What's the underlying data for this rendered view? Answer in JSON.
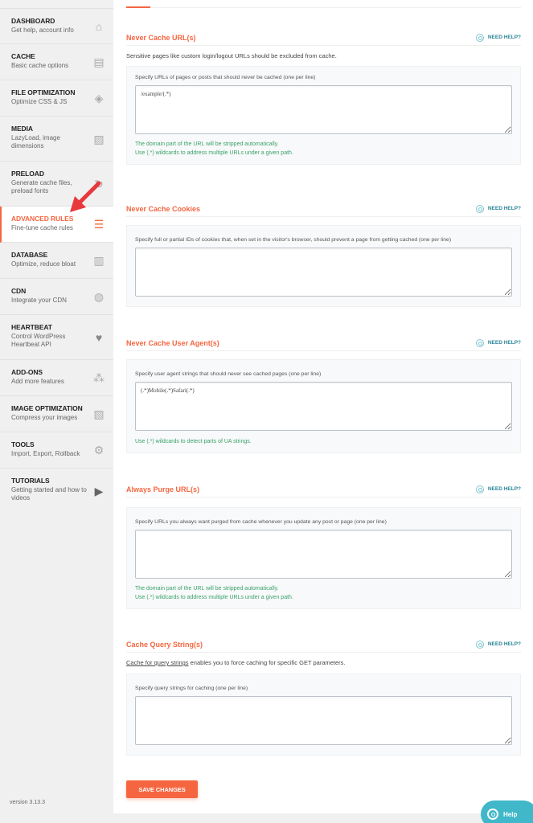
{
  "sidebar": {
    "items": [
      {
        "title": "DASHBOARD",
        "subtitle": "Get help, account info",
        "icon": "home-icon",
        "glyph": "⌂"
      },
      {
        "title": "CACHE",
        "subtitle": "Basic cache options",
        "icon": "document-icon",
        "glyph": "▤"
      },
      {
        "title": "FILE OPTIMIZATION",
        "subtitle": "Optimize CSS & JS",
        "icon": "layers-icon",
        "glyph": "◈"
      },
      {
        "title": "MEDIA",
        "subtitle": "LazyLoad, image dimensions",
        "icon": "images-icon",
        "glyph": "▨"
      },
      {
        "title": "PRELOAD",
        "subtitle": "Generate cache files, preload fonts",
        "icon": "refresh-icon",
        "glyph": "↻"
      },
      {
        "title": "ADVANCED RULES",
        "subtitle": "Fine-tune cache rules",
        "icon": "list-icon",
        "glyph": "☰",
        "active": true
      },
      {
        "title": "DATABASE",
        "subtitle": "Optimize, reduce bloat",
        "icon": "database-icon",
        "glyph": "▥"
      },
      {
        "title": "CDN",
        "subtitle": "Integrate your CDN",
        "icon": "globe-hand-icon",
        "glyph": "◍"
      },
      {
        "title": "HEARTBEAT",
        "subtitle": "Control WordPress Heartbeat API",
        "icon": "heartbeat-icon",
        "glyph": "♥"
      },
      {
        "title": "ADD-ONS",
        "subtitle": "Add more features",
        "icon": "cubes-icon",
        "glyph": "⁂"
      },
      {
        "title": "IMAGE OPTIMIZATION",
        "subtitle": "Compress your images",
        "icon": "image-compress-icon",
        "glyph": "▧"
      },
      {
        "title": "TOOLS",
        "subtitle": "Import, Export, Rollback",
        "icon": "file-gear-icon",
        "glyph": "⚙"
      },
      {
        "title": "TUTORIALS",
        "subtitle": "Getting started and how to videos",
        "icon": "play-icon",
        "glyph": "▶"
      }
    ],
    "version": "version 3.13.3"
  },
  "need_help_label": "NEED HELP?",
  "sections": [
    {
      "title": "Never Cache URL(s)",
      "description": "Sensitive pages like custom login/logout URLs should be excluded from cache.",
      "field_label": "Specify URLs of pages or posts that should never be cached (one per line)",
      "value": "/example/(.*)",
      "hints": [
        "The domain part of the URL will be stripped automatically.",
        "Use (.*) wildcards to address multiple URLs under a given path."
      ]
    },
    {
      "title": "Never Cache Cookies",
      "field_label": "Specify full or partial IDs of cookies that, when set in the visitor's browser, should prevent a page from getting cached (one per line)",
      "value": ""
    },
    {
      "title": "Never Cache User Agent(s)",
      "field_label": "Specify user agent strings that should never see cached pages (one per line)",
      "value": "(.*)Mobile(.*)Safari(.*)",
      "hints": [
        "Use (.*) wildcards to detect parts of UA strings."
      ]
    },
    {
      "title": "Always Purge URL(s)",
      "field_label": "Specify URLs you always want purged from cache whenever you update any post or page (one per line)",
      "value": "",
      "hints": [
        "The domain part of the URL will be stripped automatically.",
        "Use (.*) wildcards to address multiple URLs under a given path."
      ]
    },
    {
      "title": "Cache Query String(s)",
      "description_link": "Cache for query strings",
      "description_rest": " enables you to force caching for specific GET parameters.",
      "field_label": "Specify query strings for caching (one per line)",
      "value": ""
    }
  ],
  "save_button": "SAVE CHANGES",
  "help_fab": "Help",
  "colors": {
    "accent": "#f56640",
    "help": "#40b8c9",
    "hint": "#3aa26a"
  }
}
